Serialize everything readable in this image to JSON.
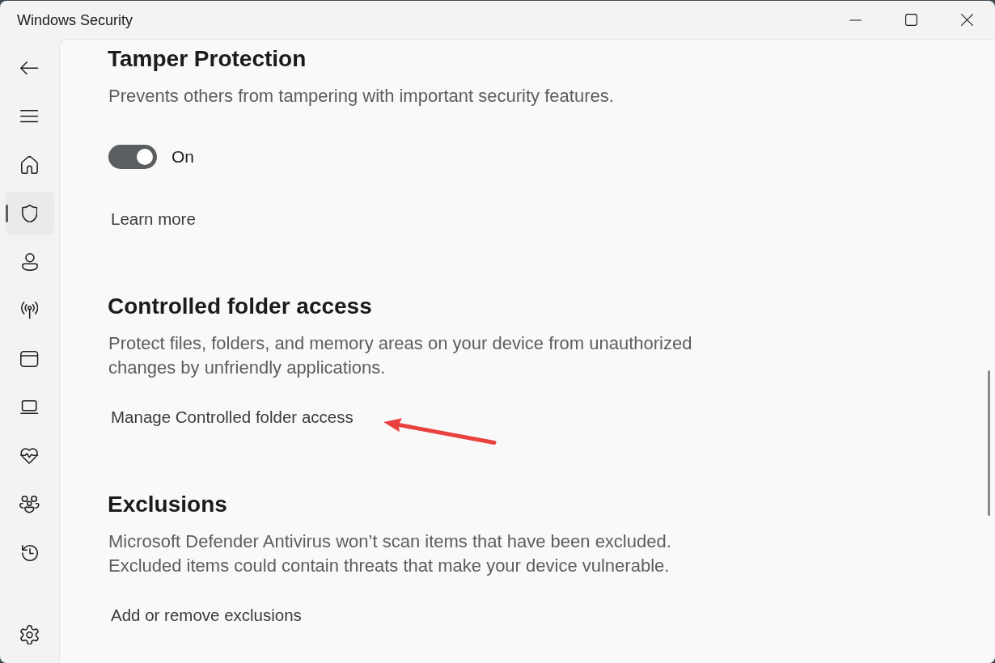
{
  "window": {
    "title": "Windows Security"
  },
  "sidebar": {
    "nav_items": [
      {
        "selected": false
      },
      {
        "selected": true
      },
      {
        "selected": false
      },
      {
        "selected": false
      },
      {
        "selected": false
      },
      {
        "selected": false
      },
      {
        "selected": false
      },
      {
        "selected": false
      },
      {
        "selected": false
      }
    ]
  },
  "sections": [
    {
      "title": "Tamper Protection",
      "description": "Prevents others from tampering with important security features.",
      "toggle": {
        "on": true,
        "label": "On"
      },
      "links": [
        {
          "text": "Learn more",
          "annotated": false
        }
      ]
    },
    {
      "title": "Controlled folder access",
      "description": "Protect files, folders, and memory areas on your device from unauthorized changes by unfriendly applications.",
      "links": [
        {
          "text": "Manage Controlled folder access",
          "annotated": true
        }
      ]
    },
    {
      "title": "Exclusions",
      "description": "Microsoft Defender Antivirus won’t scan items that have been excluded. Excluded items could contain threats that make your device vulnerable.",
      "links": [
        {
          "text": "Add or remove exclusions",
          "annotated": false
        }
      ]
    }
  ]
}
